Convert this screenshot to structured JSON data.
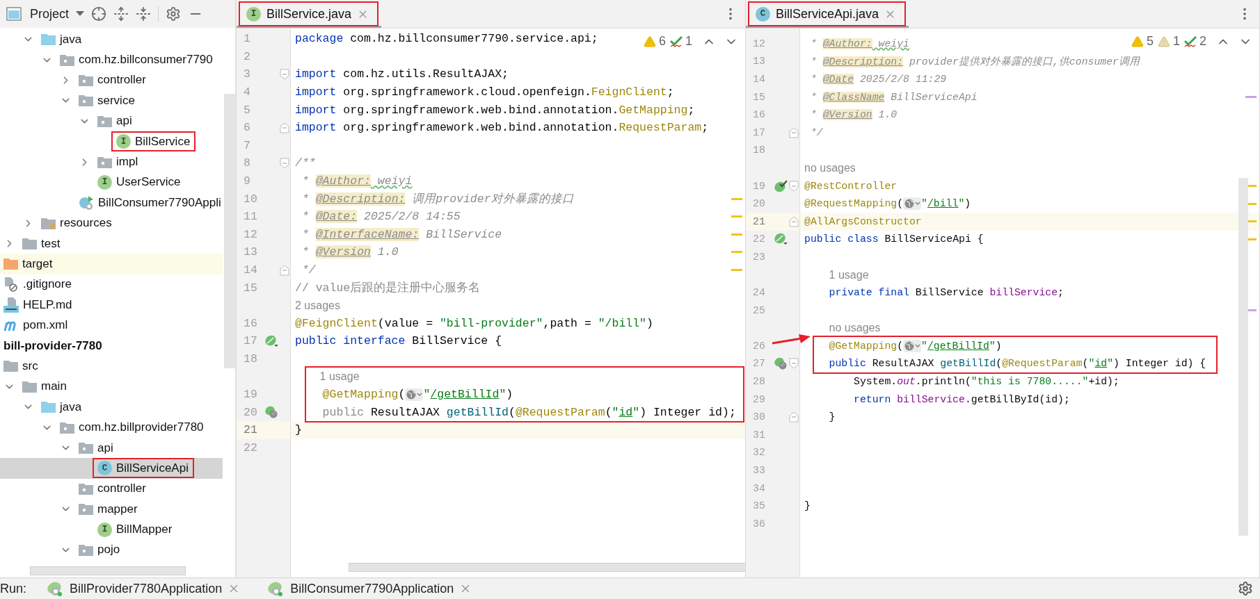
{
  "project_panel": {
    "title": "Project"
  },
  "tree": [
    {
      "label": "java",
      "kind": "source-folder",
      "expanded": true,
      "selected": false,
      "boxed": false,
      "children": [
        {
          "label": "com.hz.billconsumer7790",
          "kind": "package",
          "expanded": true,
          "selected": false,
          "boxed": false,
          "children": [
            {
              "label": "controller",
              "kind": "package",
              "expanded": false,
              "selected": false,
              "boxed": false
            },
            {
              "label": "service",
              "kind": "package",
              "expanded": true,
              "selected": false,
              "boxed": false,
              "children": [
                {
                  "label": "api",
                  "kind": "package",
                  "expanded": true,
                  "selected": false,
                  "boxed": false,
                  "children": [
                    {
                      "label": "BillService",
                      "kind": "interface",
                      "badge": "I",
                      "selected": false,
                      "boxed": true
                    }
                  ]
                },
                {
                  "label": "impl",
                  "kind": "package",
                  "expanded": false,
                  "selected": false,
                  "boxed": false
                },
                {
                  "label": "UserService",
                  "kind": "interface",
                  "badge": "I",
                  "selected": false,
                  "boxed": false
                }
              ]
            },
            {
              "label": "BillConsumer7790Appli",
              "kind": "spring-app",
              "selected": false,
              "boxed": false
            }
          ]
        }
      ]
    },
    {
      "label": "resources",
      "kind": "resources-folder",
      "expanded": false,
      "selected": false,
      "boxed": false
    },
    {
      "label": "test",
      "kind": "folder",
      "expanded": false,
      "selected": false,
      "boxed": false
    },
    {
      "label": "target",
      "kind": "excluded-folder",
      "selected": false,
      "boxed": false
    },
    {
      "label": ".gitignore",
      "kind": "ignore-file",
      "selected": false,
      "boxed": false
    },
    {
      "label": "HELP.md",
      "kind": "markdown-file",
      "selected": false,
      "boxed": false
    },
    {
      "label": "pom.xml",
      "kind": "maven-file",
      "selected": false,
      "boxed": false
    },
    {
      "label": "bill-provider-7780",
      "kind": "module",
      "selected": false,
      "boxed": false,
      "children": [
        {
          "label": "src",
          "kind": "plain-folder",
          "selected": false,
          "boxed": false,
          "children": [
            {
              "label": "main",
              "kind": "folder",
              "expanded": true,
              "selected": false,
              "boxed": false,
              "children": [
                {
                  "label": "java",
                  "kind": "source-folder",
                  "expanded": true,
                  "selected": false,
                  "boxed": false,
                  "children": [
                    {
                      "label": "com.hz.billprovider7780",
                      "kind": "package",
                      "expanded": true,
                      "selected": false,
                      "boxed": false,
                      "children": [
                        {
                          "label": "api",
                          "kind": "package",
                          "expanded": true,
                          "selected": false,
                          "boxed": false,
                          "children": [
                            {
                              "label": "BillServiceApi",
                              "kind": "class",
                              "badge": "C",
                              "selected": true,
                              "boxed": true
                            }
                          ]
                        },
                        {
                          "label": "controller",
                          "kind": "package",
                          "selected": false,
                          "boxed": false
                        },
                        {
                          "label": "mapper",
                          "kind": "package",
                          "expanded": true,
                          "selected": false,
                          "boxed": false,
                          "children": [
                            {
                              "label": "BillMapper",
                              "kind": "interface",
                              "badge": "I",
                              "selected": false,
                              "boxed": false
                            }
                          ]
                        },
                        {
                          "label": "pojo",
                          "kind": "package",
                          "expanded": true,
                          "selected": false,
                          "boxed": false
                        }
                      ]
                    }
                  ]
                }
              ]
            }
          ]
        }
      ]
    }
  ],
  "editors": [
    {
      "tab": {
        "label": "BillService.java",
        "kind": "interface",
        "badge": "I",
        "selected": true,
        "boxed": true
      },
      "inspections": [
        {
          "kind": "warning",
          "count": "6"
        },
        {
          "kind": "typo",
          "count": "1"
        }
      ],
      "callout_arrow": false,
      "rows": [
        {
          "kind": "code",
          "no": "1",
          "current": false,
          "boxed": false,
          "tokens": [
            {
              "kind": "kw",
              "text": "package"
            },
            {
              "kind": "plain",
              "text": " com.hz.billconsumer7790.service.api;"
            }
          ]
        },
        {
          "kind": "code",
          "no": "2",
          "current": false,
          "boxed": false,
          "tokens": []
        },
        {
          "kind": "code",
          "no": "3",
          "current": false,
          "boxed": false,
          "fold": {
            "kind": "start"
          },
          "tokens": [
            {
              "kind": "kw",
              "text": "import"
            },
            {
              "kind": "plain",
              "text": " com.hz.utils.ResultAJAX;"
            }
          ]
        },
        {
          "kind": "code",
          "no": "4",
          "current": false,
          "boxed": false,
          "tokens": [
            {
              "kind": "kw",
              "text": "import"
            },
            {
              "kind": "plain",
              "text": " org.springframework.cloud.openfeign."
            },
            {
              "kind": "ann",
              "text": "FeignClient"
            },
            {
              "kind": "plain",
              "text": ";"
            }
          ]
        },
        {
          "kind": "code",
          "no": "5",
          "current": false,
          "boxed": false,
          "tokens": [
            {
              "kind": "kw",
              "text": "import"
            },
            {
              "kind": "plain",
              "text": " org.springframework.web.bind.annotation."
            },
            {
              "kind": "ann",
              "text": "GetMapping"
            },
            {
              "kind": "plain",
              "text": ";"
            }
          ]
        },
        {
          "kind": "code",
          "no": "6",
          "current": false,
          "boxed": false,
          "fold": {
            "kind": "end"
          },
          "tokens": [
            {
              "kind": "kw",
              "text": "import"
            },
            {
              "kind": "plain",
              "text": " org.springframework.web.bind.annotation."
            },
            {
              "kind": "ann",
              "text": "RequestParam"
            },
            {
              "kind": "plain",
              "text": ";"
            }
          ]
        },
        {
          "kind": "code",
          "no": "7",
          "current": false,
          "boxed": false,
          "tokens": []
        },
        {
          "kind": "code",
          "no": "8",
          "current": false,
          "boxed": false,
          "fold": {
            "kind": "start"
          },
          "tokens": [
            {
              "kind": "doc",
              "text": "/**"
            }
          ]
        },
        {
          "kind": "code",
          "no": "9",
          "current": false,
          "boxed": false,
          "tokens": [
            {
              "kind": "doc",
              "text": " * "
            },
            {
              "kind": "tag",
              "text": "@Author:"
            },
            {
              "kind": "typo",
              "text": " weiyi"
            }
          ]
        },
        {
          "kind": "code",
          "no": "10",
          "current": false,
          "boxed": false,
          "stripe": {
            "kind": "warning"
          },
          "tokens": [
            {
              "kind": "doc",
              "text": " * "
            },
            {
              "kind": "tag",
              "text": "@Description:"
            },
            {
              "kind": "doc",
              "text": " 调用provider对外暴露的接口"
            }
          ]
        },
        {
          "kind": "code",
          "no": "11",
          "current": false,
          "boxed": false,
          "stripe": {
            "kind": "warning"
          },
          "tokens": [
            {
              "kind": "doc",
              "text": " * "
            },
            {
              "kind": "tag",
              "text": "@Date:"
            },
            {
              "kind": "doc",
              "text": " 2025/2/8 14:55"
            }
          ]
        },
        {
          "kind": "code",
          "no": "12",
          "current": false,
          "boxed": false,
          "stripe": {
            "kind": "warning"
          },
          "tokens": [
            {
              "kind": "doc",
              "text": " * "
            },
            {
              "kind": "tag",
              "text": "@InterfaceName:"
            },
            {
              "kind": "doc",
              "text": " BillService"
            }
          ]
        },
        {
          "kind": "code",
          "no": "13",
          "current": false,
          "boxed": false,
          "stripe": {
            "kind": "warning"
          },
          "tokens": [
            {
              "kind": "doc",
              "text": " * "
            },
            {
              "kind": "tag",
              "text": "@Version"
            },
            {
              "kind": "doc",
              "text": " 1.0"
            }
          ]
        },
        {
          "kind": "code",
          "no": "14",
          "current": false,
          "boxed": false,
          "fold": {
            "kind": "end"
          },
          "stripe": {
            "kind": "warning"
          },
          "tokens": [
            {
              "kind": "doc",
              "text": " */"
            }
          ]
        },
        {
          "kind": "code",
          "no": "15",
          "current": false,
          "boxed": false,
          "tokens": [
            {
              "kind": "comment",
              "text": "// value后跟的是注册中心服务名"
            }
          ]
        },
        {
          "kind": "hint",
          "text": "2 usages",
          "indented": false,
          "current": false,
          "boxed": false
        },
        {
          "kind": "code",
          "no": "16",
          "current": false,
          "boxed": false,
          "tokens": [
            {
              "kind": "ann",
              "text": "@FeignClient"
            },
            {
              "kind": "plain",
              "text": "(value = "
            },
            {
              "kind": "str",
              "text": "\"bill-provider\""
            },
            {
              "kind": "plain",
              "text": ",path = "
            },
            {
              "kind": "str",
              "text": "\"/bill\""
            },
            {
              "kind": "plain",
              "text": ")"
            }
          ]
        },
        {
          "kind": "code",
          "no": "17",
          "current": false,
          "boxed": false,
          "gutter": {
            "kind": "bean"
          },
          "tokens": [
            {
              "kind": "kw",
              "text": "public "
            },
            {
              "kind": "kw",
              "text": "interface"
            },
            {
              "kind": "plain",
              "text": " BillService {"
            }
          ]
        },
        {
          "kind": "code",
          "no": "18",
          "current": false,
          "boxed": false,
          "tokens": []
        },
        {
          "kind": "hint",
          "text": "1 usage",
          "indented": true,
          "current": false,
          "boxed": true
        },
        {
          "kind": "code",
          "no": "19",
          "current": false,
          "boxed": true,
          "tokens": [
            {
              "kind": "ann",
              "text": "    @GetMapping"
            },
            {
              "kind": "plain",
              "text": "("
            },
            {
              "kind": "url-icon"
            },
            {
              "kind": "str",
              "text": "\""
            },
            {
              "kind": "link",
              "text": "/getBillId"
            },
            {
              "kind": "str",
              "text": "\""
            },
            {
              "kind": "plain",
              "text": ")"
            }
          ]
        },
        {
          "kind": "code",
          "no": "20",
          "current": false,
          "boxed": true,
          "gutter": {
            "kind": "bean-web"
          },
          "tokens": [
            {
              "kind": "muted",
              "text": "    public"
            },
            {
              "kind": "plain",
              "text": " ResultAJAX "
            },
            {
              "kind": "method",
              "text": "getBillId"
            },
            {
              "kind": "plain",
              "text": "("
            },
            {
              "kind": "ann",
              "text": "@RequestParam"
            },
            {
              "kind": "plain",
              "text": "("
            },
            {
              "kind": "str",
              "text": "\""
            },
            {
              "kind": "link",
              "text": "id"
            },
            {
              "kind": "str",
              "text": "\""
            },
            {
              "kind": "plain",
              "text": ") Integer id);"
            }
          ]
        },
        {
          "kind": "code",
          "no": "21",
          "current": true,
          "boxed": false,
          "tokens": [
            {
              "kind": "plain",
              "text": "}"
            }
          ]
        },
        {
          "kind": "code",
          "no": "22",
          "current": false,
          "boxed": false,
          "tokens": []
        }
      ]
    },
    {
      "tab": {
        "label": "BillServiceApi.java",
        "kind": "class",
        "badge": "C",
        "selected": true,
        "boxed": true
      },
      "inspections": [
        {
          "kind": "warning",
          "count": "5"
        },
        {
          "kind": "weak-warning",
          "count": "1"
        },
        {
          "kind": "typo",
          "count": "2"
        }
      ],
      "callout_arrow": true,
      "rows": [
        {
          "kind": "code",
          "no": "12",
          "current": false,
          "boxed": false,
          "tokens": [
            {
              "kind": "doc",
              "text": " * "
            },
            {
              "kind": "tag",
              "text": "@Author:"
            },
            {
              "kind": "typo",
              "text": " weiyi"
            }
          ]
        },
        {
          "kind": "code",
          "no": "13",
          "current": false,
          "boxed": false,
          "tokens": [
            {
              "kind": "doc",
              "text": " * "
            },
            {
              "kind": "tag",
              "text": "@Description:"
            },
            {
              "kind": "doc",
              "text": " provider提供对外暴露的接口,供consumer调用"
            }
          ]
        },
        {
          "kind": "code",
          "no": "14",
          "current": false,
          "boxed": false,
          "tokens": [
            {
              "kind": "doc",
              "text": " * "
            },
            {
              "kind": "tag",
              "text": "@Date"
            },
            {
              "kind": "doc",
              "text": " 2025/2/8 11:29"
            }
          ]
        },
        {
          "kind": "code",
          "no": "15",
          "current": false,
          "boxed": false,
          "stripe": {
            "kind": "info"
          },
          "tokens": [
            {
              "kind": "doc",
              "text": " * "
            },
            {
              "kind": "tag",
              "text": "@ClassName"
            },
            {
              "kind": "doc",
              "text": " BillServiceApi"
            }
          ]
        },
        {
          "kind": "code",
          "no": "16",
          "current": false,
          "boxed": false,
          "tokens": [
            {
              "kind": "doc",
              "text": " * "
            },
            {
              "kind": "tag",
              "text": "@Version"
            },
            {
              "kind": "doc",
              "text": " 1.0"
            }
          ]
        },
        {
          "kind": "code",
          "no": "17",
          "current": false,
          "boxed": false,
          "fold": {
            "kind": "end"
          },
          "tokens": [
            {
              "kind": "doc",
              "text": " */"
            }
          ]
        },
        {
          "kind": "code",
          "no": "18",
          "current": false,
          "boxed": false,
          "tokens": []
        },
        {
          "kind": "hint",
          "text": "no usages",
          "indented": false,
          "current": false,
          "boxed": false
        },
        {
          "kind": "code",
          "no": "19",
          "current": false,
          "boxed": false,
          "gutter": {
            "kind": "bean-check"
          },
          "fold": {
            "kind": "start"
          },
          "stripe": {
            "kind": "warning"
          },
          "tokens": [
            {
              "kind": "ann",
              "text": "@RestController"
            }
          ]
        },
        {
          "kind": "code",
          "no": "20",
          "current": false,
          "boxed": false,
          "stripe": {
            "kind": "warning"
          },
          "tokens": [
            {
              "kind": "ann",
              "text": "@RequestMapping"
            },
            {
              "kind": "plain",
              "text": "("
            },
            {
              "kind": "url-icon"
            },
            {
              "kind": "str",
              "text": "\""
            },
            {
              "kind": "link",
              "text": "/bill"
            },
            {
              "kind": "str",
              "text": "\""
            },
            {
              "kind": "plain",
              "text": ")"
            }
          ]
        },
        {
          "kind": "code",
          "no": "21",
          "current": true,
          "boxed": false,
          "fold": {
            "kind": "end"
          },
          "stripe": {
            "kind": "warning"
          },
          "tokens": [
            {
              "kind": "ann",
              "text": "@AllArgsConstructor"
            }
          ]
        },
        {
          "kind": "code",
          "no": "22",
          "current": false,
          "boxed": false,
          "gutter": {
            "kind": "bean"
          },
          "stripe": {
            "kind": "warning"
          },
          "tokens": [
            {
              "kind": "kw",
              "text": "public "
            },
            {
              "kind": "kw",
              "text": "class"
            },
            {
              "kind": "plain",
              "text": " BillServiceApi {"
            }
          ]
        },
        {
          "kind": "code",
          "no": "23",
          "current": false,
          "boxed": false,
          "tokens": []
        },
        {
          "kind": "hint",
          "text": "1 usage",
          "indented": true,
          "current": false,
          "boxed": false
        },
        {
          "kind": "code",
          "no": "24",
          "current": false,
          "boxed": false,
          "tokens": [
            {
              "kind": "kw",
              "text": "    private final"
            },
            {
              "kind": "plain",
              "text": " BillService "
            },
            {
              "kind": "field",
              "text": "billService"
            },
            {
              "kind": "plain",
              "text": ";"
            }
          ]
        },
        {
          "kind": "code",
          "no": "25",
          "current": false,
          "boxed": false,
          "stripe": {
            "kind": "info"
          },
          "tokens": []
        },
        {
          "kind": "hint",
          "text": "no usages",
          "indented": true,
          "current": false,
          "boxed": false
        },
        {
          "kind": "code",
          "no": "26",
          "current": false,
          "boxed": true,
          "tokens": [
            {
              "kind": "ann",
              "text": "    @GetMapping"
            },
            {
              "kind": "plain",
              "text": "("
            },
            {
              "kind": "url-icon"
            },
            {
              "kind": "str",
              "text": "\""
            },
            {
              "kind": "link",
              "text": "/getBillId"
            },
            {
              "kind": "str",
              "text": "\""
            },
            {
              "kind": "plain",
              "text": ")"
            }
          ]
        },
        {
          "kind": "code",
          "no": "27",
          "current": false,
          "boxed": true,
          "gutter": {
            "kind": "bean-web"
          },
          "fold": {
            "kind": "start"
          },
          "tokens": [
            {
              "kind": "kw",
              "text": "    public"
            },
            {
              "kind": "plain",
              "text": " ResultAJAX "
            },
            {
              "kind": "method",
              "text": "getBillId"
            },
            {
              "kind": "plain",
              "text": "("
            },
            {
              "kind": "ann",
              "text": "@RequestParam"
            },
            {
              "kind": "plain",
              "text": "("
            },
            {
              "kind": "str",
              "text": "\""
            },
            {
              "kind": "link",
              "text": "id"
            },
            {
              "kind": "str",
              "text": "\""
            },
            {
              "kind": "plain",
              "text": ") Integer id) {"
            }
          ]
        },
        {
          "kind": "code",
          "no": "28",
          "current": false,
          "boxed": false,
          "tokens": [
            {
              "kind": "plain",
              "text": "        System."
            },
            {
              "kind": "static",
              "text": "out"
            },
            {
              "kind": "plain",
              "text": ".println("
            },
            {
              "kind": "str",
              "text": "\"this is 7780.....\""
            },
            {
              "kind": "plain",
              "text": "+id);"
            }
          ]
        },
        {
          "kind": "code",
          "no": "29",
          "current": false,
          "boxed": false,
          "tokens": [
            {
              "kind": "kw",
              "text": "        return "
            },
            {
              "kind": "field",
              "text": "billService"
            },
            {
              "kind": "plain",
              "text": ".getBillById(id);"
            }
          ]
        },
        {
          "kind": "code",
          "no": "30",
          "current": false,
          "boxed": false,
          "fold": {
            "kind": "end"
          },
          "tokens": [
            {
              "kind": "plain",
              "text": "    }"
            }
          ]
        },
        {
          "kind": "code",
          "no": "31",
          "current": false,
          "boxed": false,
          "tokens": []
        },
        {
          "kind": "code",
          "no": "32",
          "current": false,
          "boxed": false,
          "tokens": []
        },
        {
          "kind": "code",
          "no": "33",
          "current": false,
          "boxed": false,
          "tokens": []
        },
        {
          "kind": "code",
          "no": "34",
          "current": false,
          "boxed": false,
          "tokens": []
        },
        {
          "kind": "code",
          "no": "35",
          "current": false,
          "boxed": false,
          "tokens": [
            {
              "kind": "plain",
              "text": "}"
            }
          ]
        },
        {
          "kind": "code",
          "no": "36",
          "current": false,
          "boxed": false,
          "tokens": []
        }
      ]
    }
  ],
  "run_bar": {
    "label": "Run:",
    "tabs": [
      {
        "label": "BillProvider7780Application",
        "selected": false
      },
      {
        "label": "BillConsumer7790Application",
        "selected": false
      }
    ]
  }
}
